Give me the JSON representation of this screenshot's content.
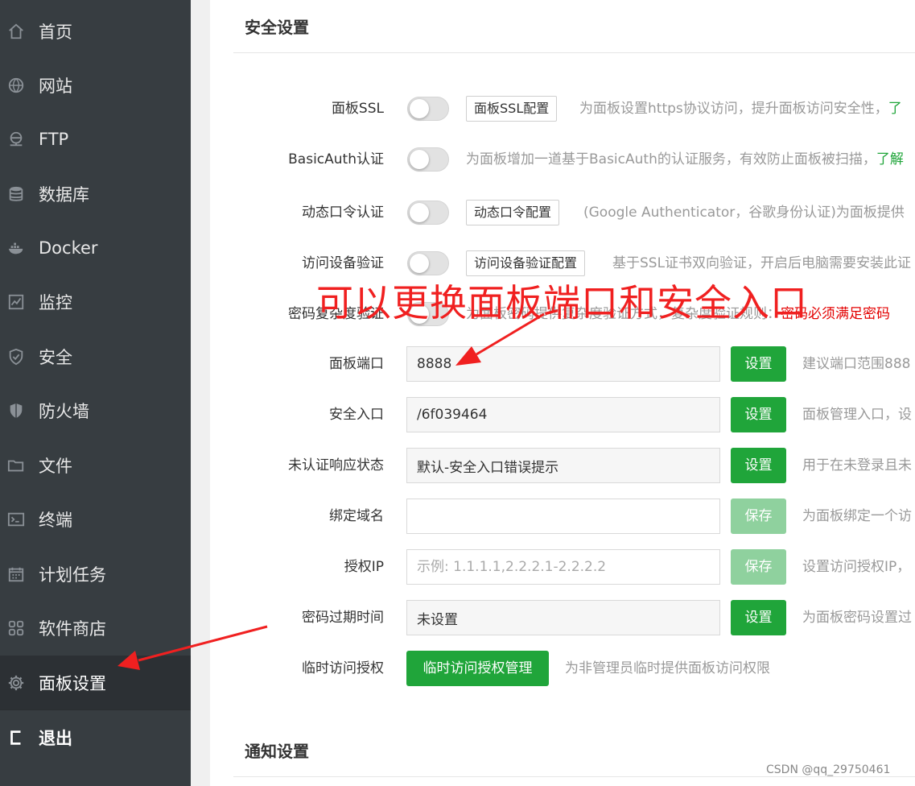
{
  "sidebar": {
    "items": [
      {
        "label": "首页",
        "icon": "home-icon"
      },
      {
        "label": "网站",
        "icon": "globe-icon"
      },
      {
        "label": "FTP",
        "icon": "ftp-icon"
      },
      {
        "label": "数据库",
        "icon": "database-icon"
      },
      {
        "label": "Docker",
        "icon": "docker-icon"
      },
      {
        "label": "监控",
        "icon": "monitor-icon"
      },
      {
        "label": "安全",
        "icon": "shield-check-icon"
      },
      {
        "label": "防火墙",
        "icon": "firewall-shield-icon"
      },
      {
        "label": "文件",
        "icon": "folder-icon"
      },
      {
        "label": "终端",
        "icon": "terminal-icon"
      },
      {
        "label": "计划任务",
        "icon": "calendar-icon"
      },
      {
        "label": "软件商店",
        "icon": "grid-icon"
      },
      {
        "label": "面板设置",
        "icon": "gear-icon"
      },
      {
        "label": "退出",
        "icon": "logout-icon"
      }
    ],
    "active_item": "面板设置"
  },
  "main": {
    "security_section_title": "安全设置",
    "notify_section_title": "通知设置",
    "toggles": [
      {
        "label": "面板SSL",
        "button": "面板SSL配置",
        "desc": "为面板设置https协议访问，提升面板访问安全性，",
        "link": "了"
      },
      {
        "label": "BasicAuth认证",
        "desc": "为面板增加一道基于BasicAuth的认证服务，有效防止面板被扫描，",
        "link": "了解"
      },
      {
        "label": "动态口令认证",
        "button": "动态口令配置",
        "desc": "(Google Authenticator，谷歌身份认证)为面板提供"
      },
      {
        "label": "访问设备验证",
        "button": "访问设备验证配置",
        "desc": "基于SSL证书双向验证，开启后电脑需要安装此证"
      },
      {
        "label": "密码复杂度验证",
        "desc": "为面板密码提供复杂度验证方式，复杂度验证规则：",
        "warn": "密码必须满足密码"
      }
    ],
    "fields": [
      {
        "label": "面板端口",
        "value": "8888",
        "button": "设置",
        "desc": "建议端口范围888"
      },
      {
        "label": "安全入口",
        "value": "/6f039464",
        "button": "设置",
        "desc": "面板管理入口，设"
      },
      {
        "label": "未认证响应状态",
        "value": "默认-安全入口错误提示",
        "button": "设置",
        "desc": "用于在未登录且未"
      },
      {
        "label": "绑定域名",
        "value": "",
        "button": "保存",
        "desc": "为面板绑定一个访"
      },
      {
        "label": "授权IP",
        "placeholder": "示例: 1.1.1.1,2.2.2.1-2.2.2.2",
        "button": "保存",
        "desc": "设置访问授权IP，"
      },
      {
        "label": "密码过期时间",
        "value": "未设置",
        "button": "设置",
        "desc": "为面板密码设置过"
      }
    ],
    "temp_access": {
      "label": "临时访问授权",
      "button": "临时访问授权管理",
      "desc": "为非管理员临时提供面板访问权限"
    }
  },
  "annotation": {
    "text": "可以更换面板端口和安全入口",
    "color": "#f02020"
  },
  "watermark": "CSDN @qq_29750461"
}
